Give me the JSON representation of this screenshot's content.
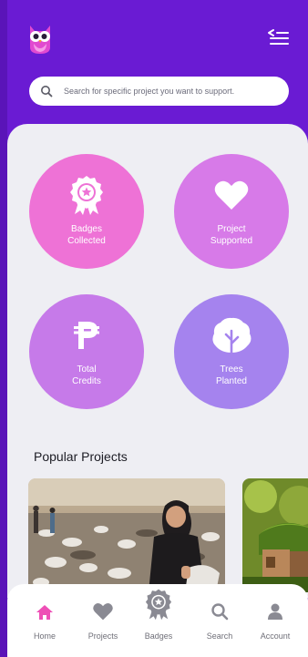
{
  "search": {
    "placeholder": "Search for specific project you want to support."
  },
  "stats": {
    "badges": {
      "line1": "Badges",
      "line2": "Collected",
      "icon": "badge-icon"
    },
    "projects": {
      "line1": "Project",
      "line2": "Supported",
      "icon": "heart-icon"
    },
    "credits": {
      "line1": "Total",
      "line2": "Credits",
      "icon": "peso-icon"
    },
    "trees": {
      "line1": "Trees",
      "line2": "Planted",
      "icon": "tree-icon"
    }
  },
  "popular": {
    "title": "Popular Projects"
  },
  "nav": {
    "home": "Home",
    "projects": "Projects",
    "badges": "Badges",
    "search": "Search",
    "account": "Account"
  },
  "colors": {
    "header": "#6a1bd3",
    "accent": "#ee4fb6",
    "badges_circle": "#ee72d6",
    "projects_circle": "#d77ae8",
    "credits_circle": "#c67ae9",
    "trees_circle": "#a583ee"
  }
}
